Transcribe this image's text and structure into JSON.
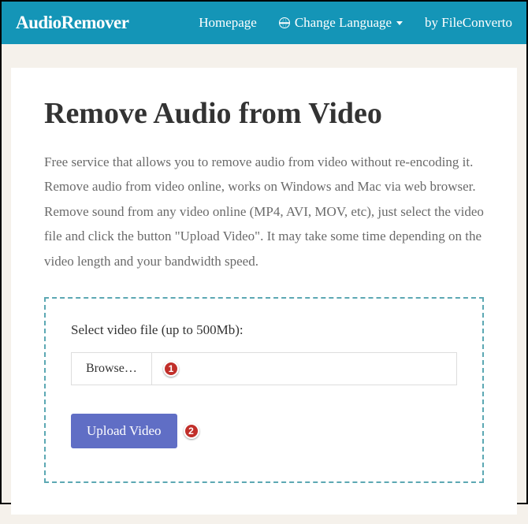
{
  "nav": {
    "brand": "AudioRemover",
    "homepage": "Homepage",
    "change_language": "Change Language",
    "by_converto": "by FileConverto"
  },
  "page": {
    "title": "Remove Audio from Video",
    "description": "Free service that allows you to remove audio from video without re-encoding it. Remove audio from video online, works on Windows and Mac via web browser. Remove sound from any video online (MP4, AVI, MOV, etc), just select the video file and click the button \"Upload Video\". It may take some time depending on the video length and your bandwidth speed."
  },
  "form": {
    "select_label": "Select video file (up to 500Mb):",
    "browse_label": "Browse…",
    "upload_label": "Upload Video"
  },
  "annotations": {
    "step1": "1",
    "step2": "2"
  }
}
